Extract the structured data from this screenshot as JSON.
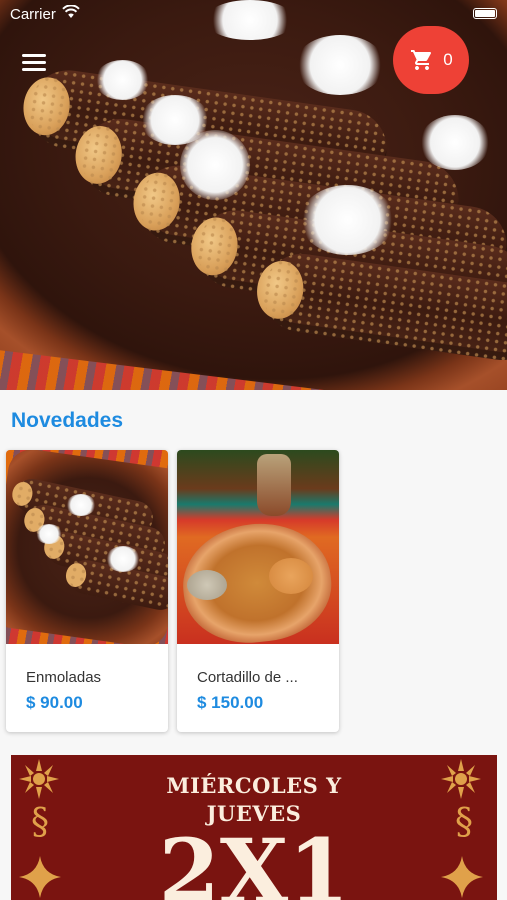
{
  "status_bar": {
    "carrier": "Carrier",
    "wifi_icon": "wifi-icon",
    "battery_icon": "battery-icon"
  },
  "header": {
    "menu_icon": "hamburger-menu-icon",
    "cart_icon": "shopping-cart-icon",
    "cart_count": "0",
    "cart_color": "#ee4136"
  },
  "hero": {
    "image": "enmoladas-hero-photo"
  },
  "news": {
    "title": "Novedades",
    "accent_color": "#1e8be0",
    "items": [
      {
        "name": "Enmoladas",
        "price": "$ 90.00",
        "image": "enmoladas-photo"
      },
      {
        "name": "Cortadillo de ...",
        "price": "$ 150.00",
        "image": "cortadillo-photo"
      }
    ]
  },
  "promo": {
    "line1": "MIÉRCOLES Y",
    "line2": "JUEVES",
    "big": "2X1",
    "background": "#7a1410"
  }
}
